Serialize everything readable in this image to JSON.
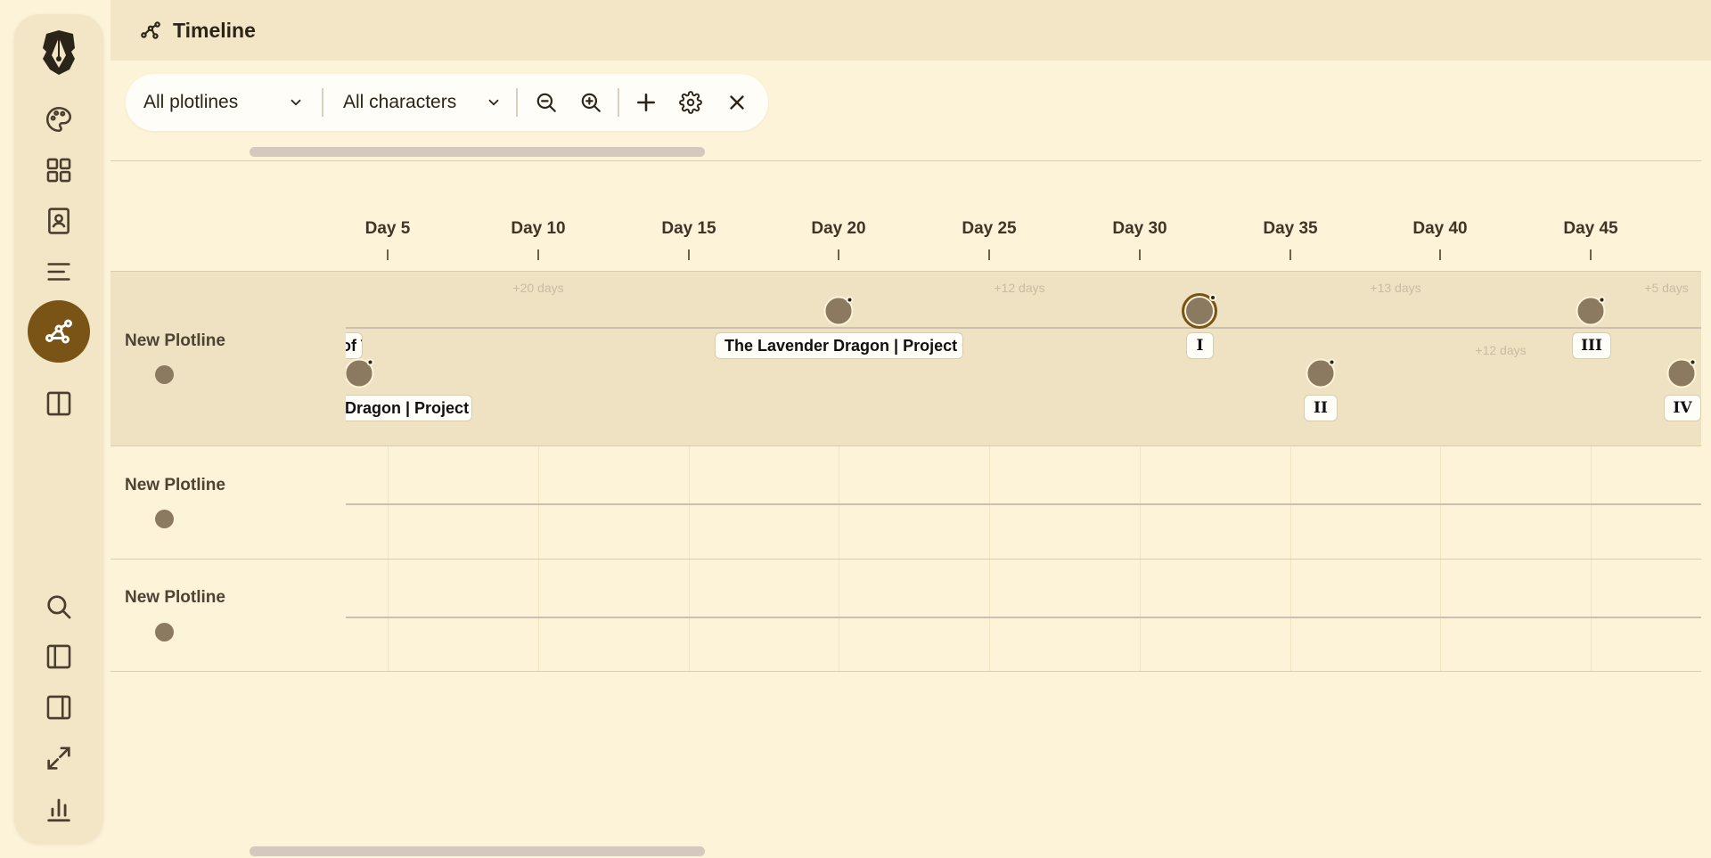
{
  "app": {
    "view_title": "Timeline"
  },
  "rail": {
    "items": [
      {
        "name": "logo-icon"
      },
      {
        "name": "palette-icon"
      },
      {
        "name": "grid-icon"
      },
      {
        "name": "contacts-book-icon"
      },
      {
        "name": "text-lines-icon"
      },
      {
        "name": "timeline-icon",
        "active": true
      },
      {
        "name": "split-view-icon"
      },
      {
        "name": "search-icon"
      },
      {
        "name": "left-panel-icon"
      },
      {
        "name": "right-panel-icon"
      },
      {
        "name": "expand-icon"
      },
      {
        "name": "stats-icon"
      }
    ]
  },
  "toolbar": {
    "plotlines_select": "All plotlines",
    "characters_select": "All characters",
    "zoom_out": "zoom-out-icon",
    "zoom_in": "zoom-in-icon",
    "add": "plus-icon",
    "settings": "gear-icon",
    "close": "close-icon"
  },
  "ruler": {
    "days": [
      "Day 5",
      "Day 10",
      "Day 15",
      "Day 20",
      "Day 25",
      "Day 30",
      "Day 35",
      "Day 40",
      "Day 45"
    ]
  },
  "plotlines": [
    {
      "name": "New Plotline",
      "gaps": [
        "+20 days",
        "+12 days",
        "+13 days",
        "+5 days",
        "+12 days"
      ],
      "events": [
        {
          "label": "of T"
        },
        {
          "label": "The Lavender Dragon | Project Gu"
        },
        {
          "label": "I"
        },
        {
          "label": "III"
        },
        {
          "label": "Dragon | Project Gu"
        },
        {
          "label": "II"
        },
        {
          "label": "IV"
        }
      ]
    },
    {
      "name": "New Plotline"
    },
    {
      "name": "New Plotline"
    }
  ],
  "colors": {
    "background": "#fdf3d9",
    "header": "#f3e6c6",
    "accent": "#7a5417",
    "node": "#8b7a5f"
  }
}
